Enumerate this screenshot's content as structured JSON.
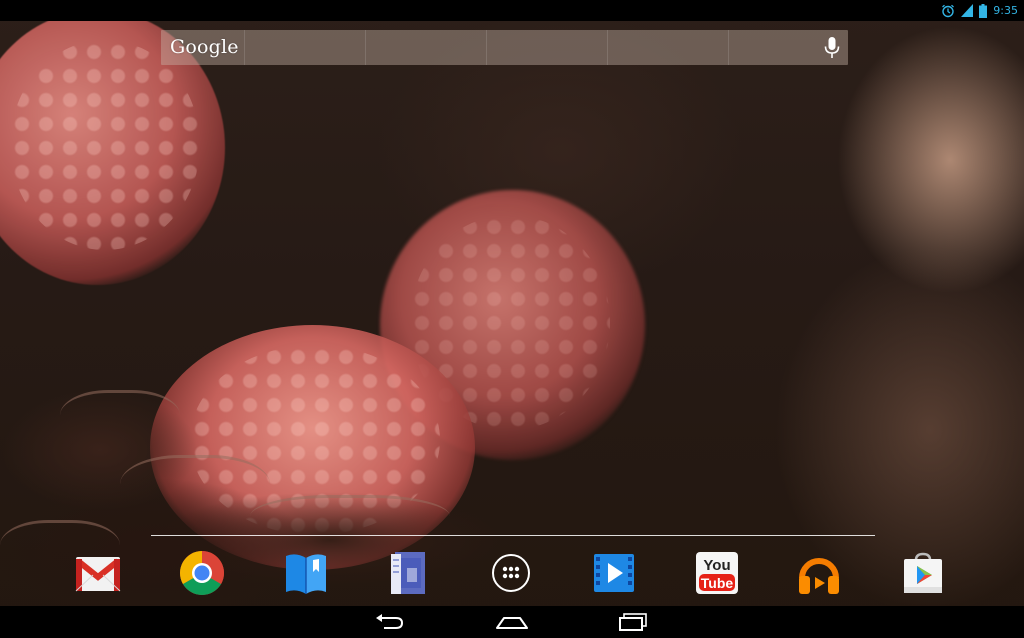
{
  "status_bar": {
    "time": "9:35",
    "icons": [
      "alarm-icon",
      "signal-icon",
      "battery-icon"
    ],
    "accent_color": "#33b5e5"
  },
  "search": {
    "logo_text": "Google",
    "voice_icon": "mic-icon"
  },
  "dock": {
    "apps": [
      {
        "icon": "gmail-icon"
      },
      {
        "icon": "chrome-icon"
      },
      {
        "icon": "play-books-icon"
      },
      {
        "icon": "play-magazines-icon"
      },
      {
        "icon": "all-apps-icon"
      },
      {
        "icon": "play-movies-icon"
      },
      {
        "icon": "youtube-icon",
        "text_top": "You",
        "text_bottom": "Tube"
      },
      {
        "icon": "play-music-icon"
      },
      {
        "icon": "play-store-icon"
      }
    ]
  },
  "nav_bar": {
    "buttons": [
      "back-icon",
      "home-icon",
      "recent-apps-icon"
    ]
  },
  "wallpaper": {
    "subject": "raspberries-chocolate",
    "colors": {
      "berry": "#d9746c",
      "background": "#2a1c17",
      "chocolate": "#2b1a12"
    }
  }
}
